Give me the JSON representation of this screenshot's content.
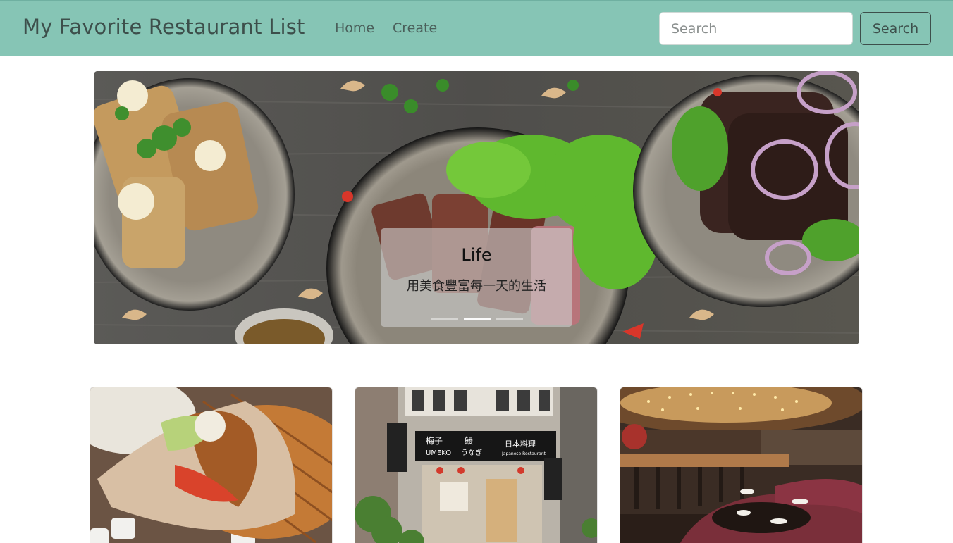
{
  "navbar": {
    "brand": "My Favorite Restaurant List",
    "links": [
      {
        "label": "Home"
      },
      {
        "label": "Create"
      }
    ],
    "search": {
      "placeholder": "Search",
      "value": "",
      "button_label": "Search"
    },
    "background_color": "#86c5b5"
  },
  "carousel": {
    "active_index": 1,
    "slide_count": 3,
    "caption": {
      "title": "Life",
      "text": "用美食豐富每一天的生活"
    }
  },
  "restaurants": [
    {
      "photo_subject": "pita wrap with fried cutlet in wicker basket"
    },
    {
      "photo_subject": "umeko japanese unagi restaurant storefront",
      "sign_text": [
        "梅子",
        "鰻",
        "うなぎ",
        "UMEKO",
        "日本料理",
        "Japanese Restaurant"
      ]
    },
    {
      "photo_subject": "upscale restaurant interior with bar and booth seating"
    }
  ]
}
